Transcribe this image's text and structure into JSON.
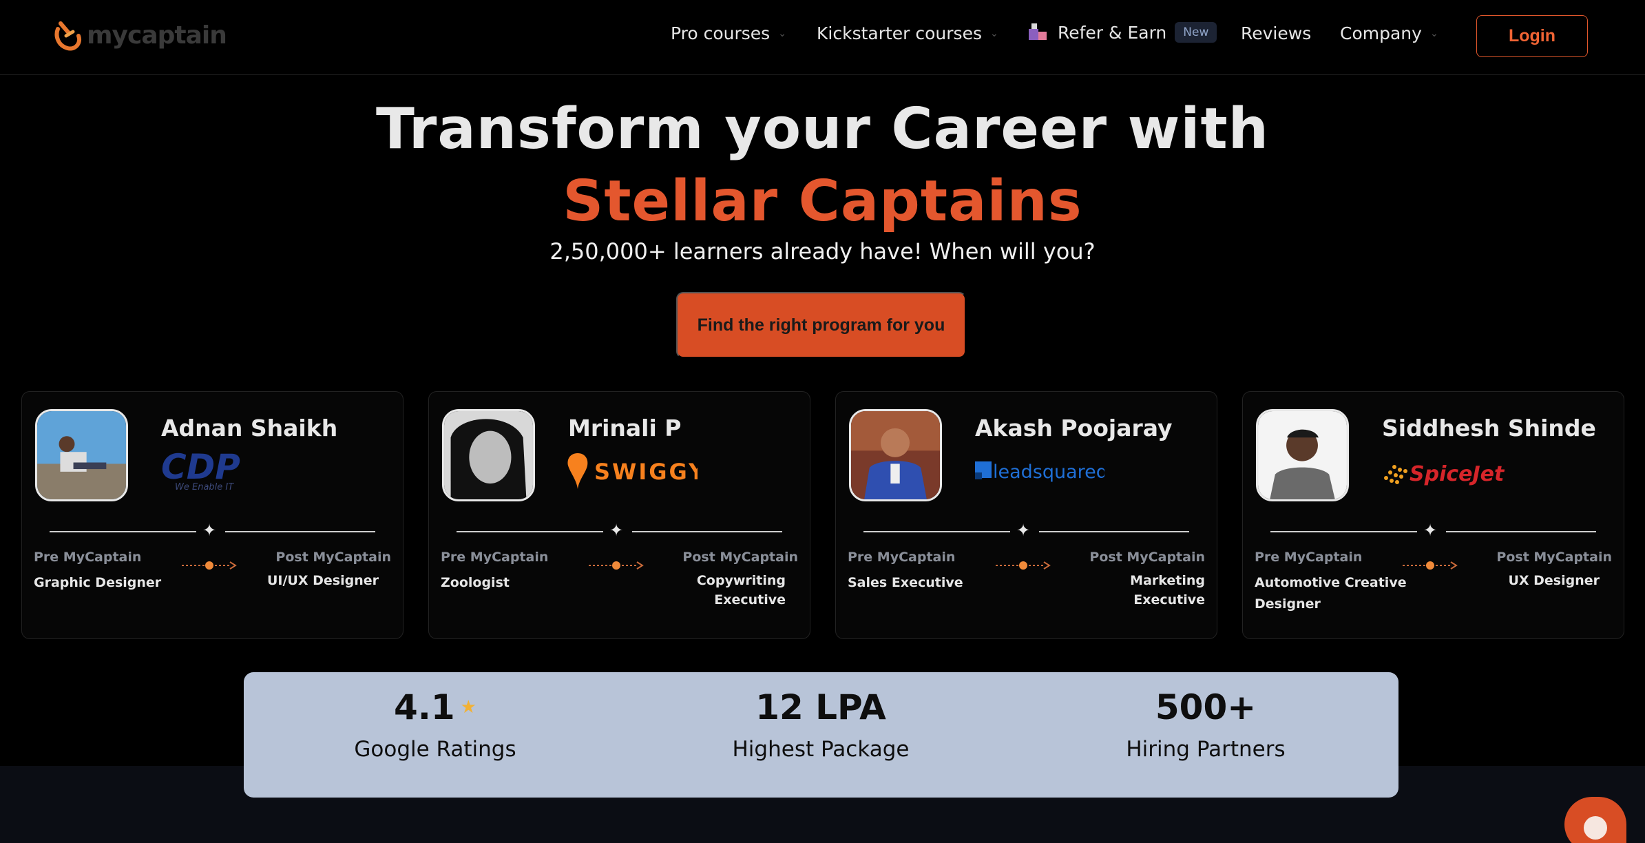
{
  "brand": {
    "name": "mycaptain",
    "accent": "#e4572e"
  },
  "nav": {
    "items": [
      {
        "label": "Pro courses",
        "has_dropdown": true
      },
      {
        "label": "Kickstarter courses",
        "has_dropdown": true
      },
      {
        "label": "Refer & Earn",
        "badge": "New"
      },
      {
        "label": "Reviews"
      },
      {
        "label": "Company",
        "has_dropdown": true
      }
    ],
    "login_label": "Login"
  },
  "hero": {
    "line1": "Transform your Career with",
    "line2": "Stellar Captains",
    "subtitle": "2,50,000+ learners already have! When will you?",
    "cta_label": "Find the right program for you"
  },
  "cards": [
    {
      "name": "Adnan Shaikh",
      "company": "CDP",
      "company_tagline": "We Enable IT",
      "pre_label": "Pre MyCaptain",
      "pre_role": "Graphic Designer",
      "post_label": "Post MyCaptain",
      "post_role": "UI/UX Designer"
    },
    {
      "name": "Mrinali P",
      "company": "SWIGGY",
      "pre_label": "Pre MyCaptain",
      "pre_role": "Zoologist",
      "post_label": "Post MyCaptain",
      "post_role": "Copywriting Executive"
    },
    {
      "name": "Akash Poojaray",
      "company": "leadsquared",
      "pre_label": "Pre MyCaptain",
      "pre_role": "Sales Executive",
      "post_label": "Post MyCaptain",
      "post_role": "Marketing Executive"
    },
    {
      "name": "Siddhesh Shinde",
      "company": "SpiceJet",
      "pre_label": "Pre MyCaptain",
      "pre_role": "Automotive Creative Designer",
      "post_label": "Post MyCaptain",
      "post_role": "UX Designer"
    }
  ],
  "stats": [
    {
      "value": "4.1",
      "label": "Google Ratings",
      "icon": "star-icon"
    },
    {
      "value": "12 LPA",
      "label": "Highest Package"
    },
    {
      "value": "500+",
      "label": "Hiring Partners"
    }
  ]
}
